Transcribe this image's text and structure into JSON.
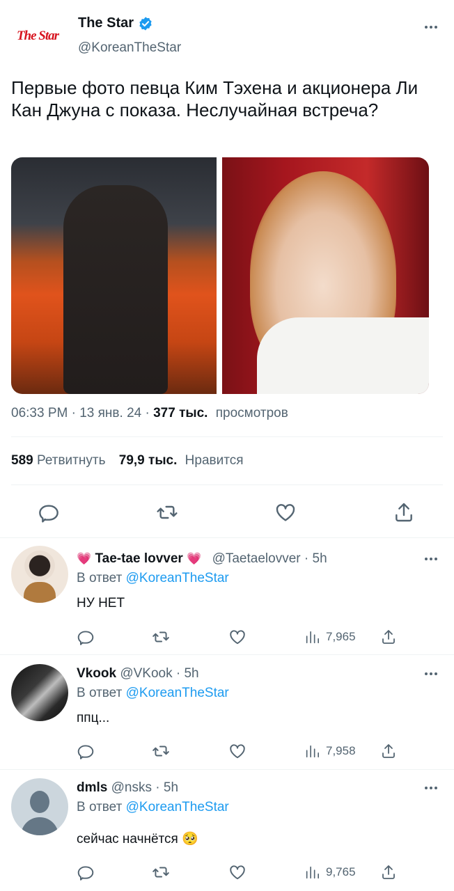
{
  "tweet": {
    "author_name": "The Star",
    "author_handle": "@KoreanTheStar",
    "logo_text": "The Star",
    "text": "Первые фото певца Ким Тэхена и акционера Ли Кан Джуна с показа. Неслучайная встреча?",
    "time": "06:33 PM",
    "date": "13 янв. 24",
    "views_count": "377 тыс.",
    "views_label": "просмотров",
    "retweets_count": "589",
    "retweets_label": "Ретвитнуть",
    "likes_count": "79,9 тыс.",
    "likes_label": "Нравится",
    "separator": "·"
  },
  "replies": [
    {
      "name": "Tae-tae lovver",
      "name_prefix": "💗",
      "name_suffix": "💗",
      "handle": "@Taetaelovver",
      "time": "5h",
      "reply_label": "В ответ",
      "reply_to": "@KoreanTheStar",
      "text": "НУ НЕТ",
      "views": "7,965"
    },
    {
      "name": "Vkook",
      "handle": "@VKook",
      "time": "5h",
      "reply_label": "В ответ",
      "reply_to": "@KoreanTheStar",
      "text": "ппц...",
      "views": "7,958"
    },
    {
      "name": "dmls",
      "handle": "@nsks",
      "time": "5h",
      "reply_label": "В ответ",
      "reply_to": "@KoreanTheStar",
      "text": "сейчас начнётся 🥺",
      "views": "9,765"
    }
  ],
  "colors": {
    "accent": "#1d9bf0",
    "secondary_text": "#536471",
    "logo_red": "#d7141f",
    "divider": "#eff3f4"
  },
  "icons": [
    "verified-badge-icon",
    "more-icon",
    "reply-icon",
    "retweet-icon",
    "like-icon",
    "share-icon",
    "views-icon",
    "heart-emoji-icon"
  ]
}
